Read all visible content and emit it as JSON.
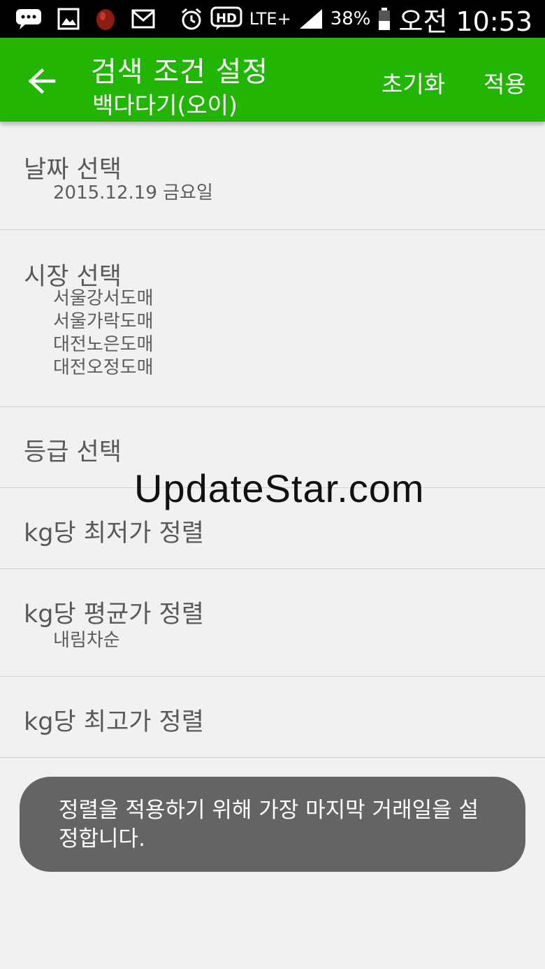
{
  "status_bar": {
    "icons": [
      "chat-bubble-icon",
      "image-icon",
      "app-icon",
      "gmail-icon",
      "alarm-icon",
      "hd-voice-icon",
      "lte-plus-icon",
      "signal-icon",
      "battery-icon"
    ],
    "hd": "HD",
    "lte": "LTE+",
    "battery_percent": "38%",
    "time": "오전 10:53"
  },
  "app_bar": {
    "title": "검색 조건 설정",
    "subtitle": "백다다기(오이)",
    "reset_label": "초기화",
    "apply_label": "적용",
    "background": "#22b503"
  },
  "settings": {
    "date": {
      "title": "날짜 선택",
      "value": "2015.12.19 금요일"
    },
    "market": {
      "title": "시장 선택",
      "values": [
        "서울강서도매",
        "서울가락도매",
        "대전노은도매",
        "대전오정도매"
      ]
    },
    "grade": {
      "title": "등급 선택"
    },
    "sort_min": {
      "title": "kg당 최저가 정렬"
    },
    "sort_avg": {
      "title": "kg당 평균가 정렬",
      "value": "내림차순"
    },
    "sort_max": {
      "title": "kg당 최고가 정렬"
    }
  },
  "watermark": "UpdateStar.com",
  "toast": {
    "message": "정렬을 적용하기 위해 가장 마지막 거래일을 설정합니다."
  }
}
